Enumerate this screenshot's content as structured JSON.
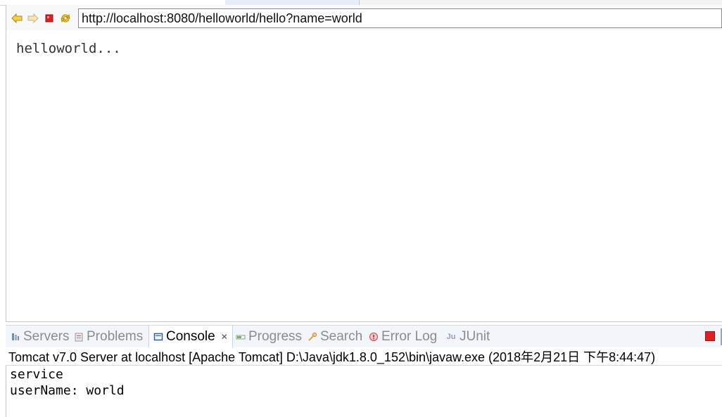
{
  "browser": {
    "url": "http://localhost:8080/helloworld/hello?name=world",
    "page_text": "helloworld..."
  },
  "views": {
    "tabs": [
      {
        "label": "Servers",
        "icon": "servers-icon"
      },
      {
        "label": "Problems",
        "icon": "problems-icon"
      },
      {
        "label": "Console",
        "icon": "console-icon"
      },
      {
        "label": "Progress",
        "icon": "progress-icon"
      },
      {
        "label": "Search",
        "icon": "search-icon"
      },
      {
        "label": "Error Log",
        "icon": "error-log-icon"
      },
      {
        "label": "JUnit",
        "icon": "junit-icon"
      }
    ],
    "active_tab": "Console"
  },
  "console": {
    "header": "Tomcat v7.0 Server at localhost [Apache Tomcat] D:\\Java\\jdk1.8.0_152\\bin\\javaw.exe (2018年2月21日 下午8:44:47)",
    "lines": [
      "service",
      "userName: world"
    ]
  },
  "colors": {
    "accent_blue": "#1f5fbf",
    "stop_red": "#e02020",
    "inactive_text": "#8c8c8c"
  }
}
